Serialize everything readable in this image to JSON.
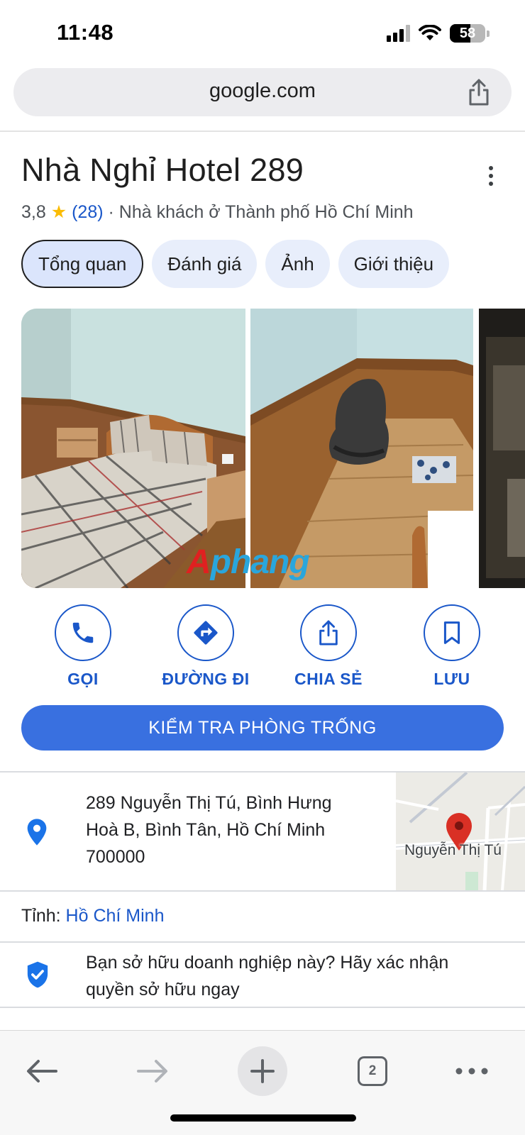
{
  "status_bar": {
    "time": "11:48",
    "battery": "58",
    "battery_level": 0.58,
    "signal_icon": "cellular-signal-icon",
    "wifi_icon": "wifi-icon"
  },
  "browser": {
    "url": "google.com",
    "share_icon": "share-icon"
  },
  "place": {
    "title": "Nhà Nghỉ Hotel 289",
    "rating": "3,8",
    "star": "★",
    "review_count": "(28)",
    "separator": "·",
    "category": "Nhà khách ở Thành phố Hồ Chí Minh"
  },
  "tabs": [
    {
      "label": "Tổng quan",
      "active": true
    },
    {
      "label": "Đánh giá",
      "active": false
    },
    {
      "label": "Ảnh",
      "active": false
    },
    {
      "label": "Giới thiệu",
      "active": false
    }
  ],
  "photos": {
    "watermark_first": "A",
    "watermark_rest": "phang"
  },
  "actions": [
    {
      "label": "GỌI",
      "icon": "phone-icon"
    },
    {
      "label": "ĐƯỜNG ĐI",
      "icon": "directions-icon"
    },
    {
      "label": "CHIA SẺ",
      "icon": "share-icon"
    },
    {
      "label": "LƯU",
      "icon": "bookmark-icon"
    }
  ],
  "cta_label": "KIỂM TRA PHÒNG TRỐNG",
  "address": {
    "line1": "289 Nguyễn Thị Tú, Bình Hưng",
    "line2": "Hoà B, Bình Tân, Hồ Chí Minh",
    "line3": "700000",
    "map_street": "Nguyễn Thị Tú"
  },
  "province": {
    "label": "Tỉnh:",
    "value": "Hồ Chí Minh"
  },
  "claim": {
    "line1": "Bạn sở hữu doanh nghiệp này? Hãy xác nhận",
    "line2": "quyền sở hữu ngay"
  },
  "bottom_bar": {
    "tab_count": "2"
  },
  "colors": {
    "accent": "#1a57c9",
    "cta": "#3970e0",
    "star": "#fbbc04",
    "chip": "#e8eefb",
    "pin": "#d93025"
  }
}
